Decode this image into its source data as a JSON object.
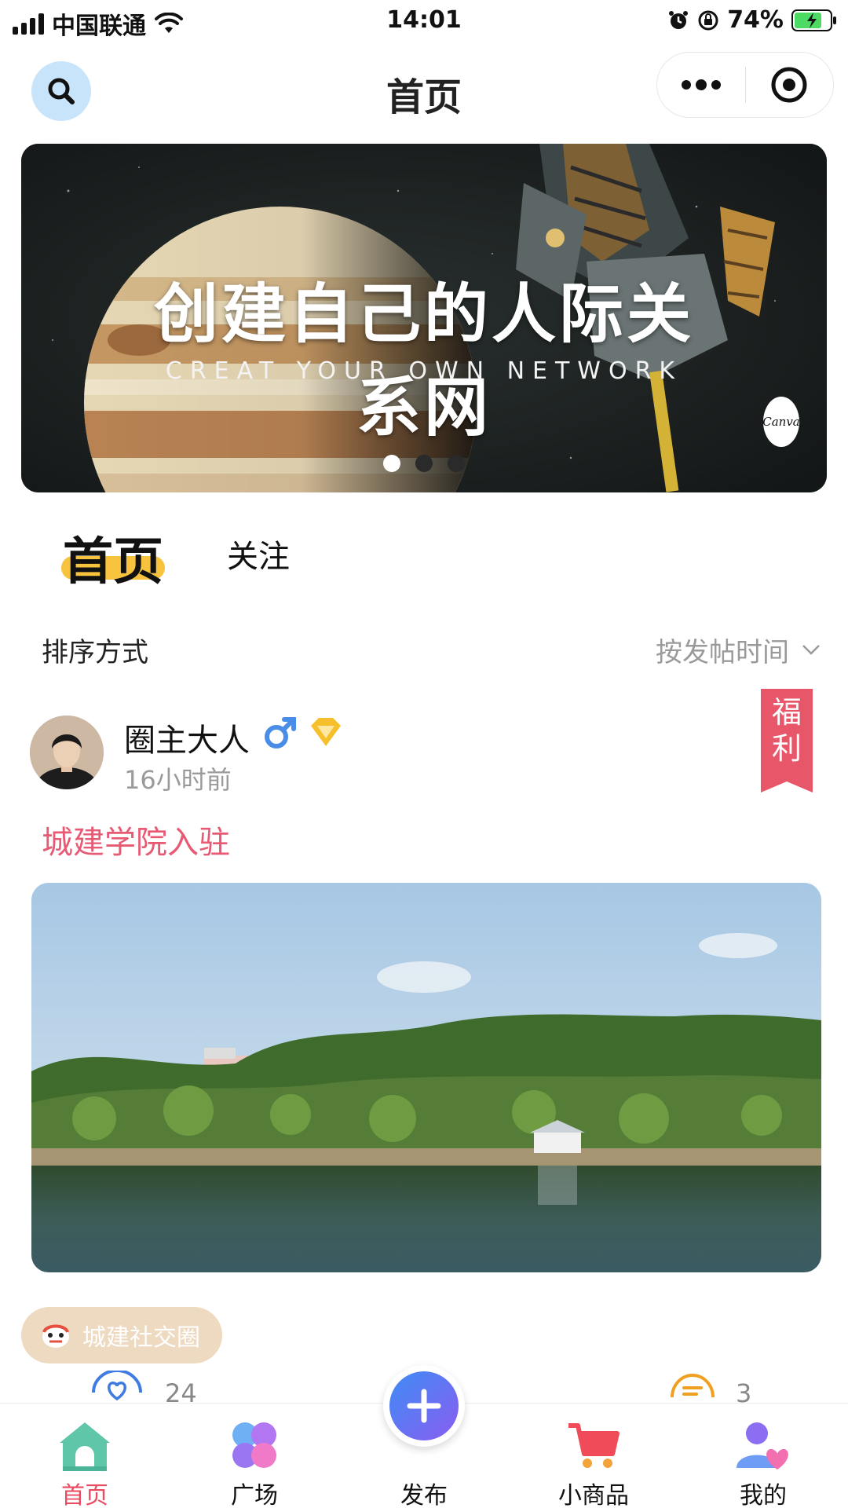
{
  "status_bar": {
    "carrier": "中国联通",
    "time": "14:01",
    "battery": "74%"
  },
  "nav": {
    "title": "首页"
  },
  "banner": {
    "title": "创建自己的人际关系网",
    "subtitle": "CREAT YOUR OWN NETWORK",
    "badge": "Canva",
    "page_count": 3,
    "active_page": 0
  },
  "tabs": {
    "home": "首页",
    "follow": "关注"
  },
  "sort": {
    "label": "排序方式",
    "value": "按发帖时间"
  },
  "post": {
    "author": "圈主大人",
    "time": "16小时前",
    "ribbon": "福利",
    "title": "城建学院入驻",
    "circle": "城建社交圈",
    "likes": "24",
    "comments": "3"
  },
  "tab_bar": {
    "items": [
      {
        "label": "首页",
        "active": true
      },
      {
        "label": "广场",
        "active": false
      },
      {
        "label": "发布",
        "active": false
      },
      {
        "label": "小商品",
        "active": false
      },
      {
        "label": "我的",
        "active": false
      }
    ]
  },
  "colors": {
    "accent_red": "#e94b60",
    "post_title": "#e85a74",
    "tab_highlight": "#f7c23d",
    "search_bg": "#c7e4fb",
    "circle_tag_bg": "#eedac0"
  }
}
